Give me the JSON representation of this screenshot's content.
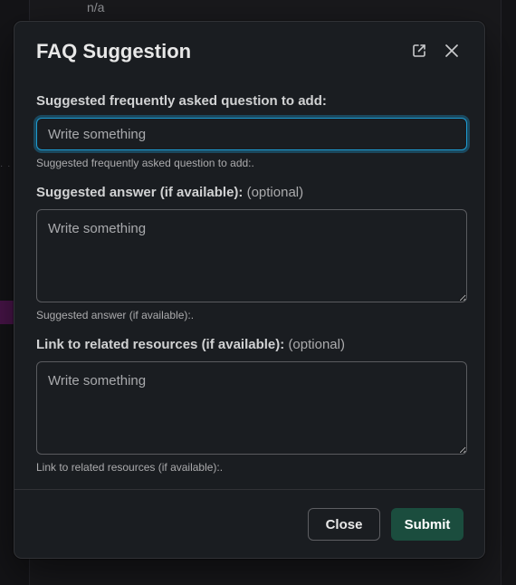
{
  "background": {
    "top_text": "n/a"
  },
  "modal": {
    "title": "FAQ Suggestion",
    "popout_icon": "external-link-icon",
    "close_icon": "close-icon",
    "fields": [
      {
        "label": "Suggested frequently asked question to add:",
        "optional": "",
        "placeholder": "Write something",
        "value": "",
        "hint": "Suggested frequently asked question to add:."
      },
      {
        "label": "Suggested answer (if available):",
        "optional": "(optional)",
        "placeholder": "Write something",
        "value": "",
        "hint": "Suggested answer (if available):."
      },
      {
        "label": "Link to related resources (if available):",
        "optional": "(optional)",
        "placeholder": "Write something",
        "value": "",
        "hint": "Link to related resources (if available):."
      }
    ],
    "buttons": {
      "cancel": "Close",
      "submit": "Submit"
    },
    "colors": {
      "focus_ring": "#1d9bd1",
      "submit_bg": "#1b4d3e",
      "modal_bg": "#1a1d21"
    }
  }
}
